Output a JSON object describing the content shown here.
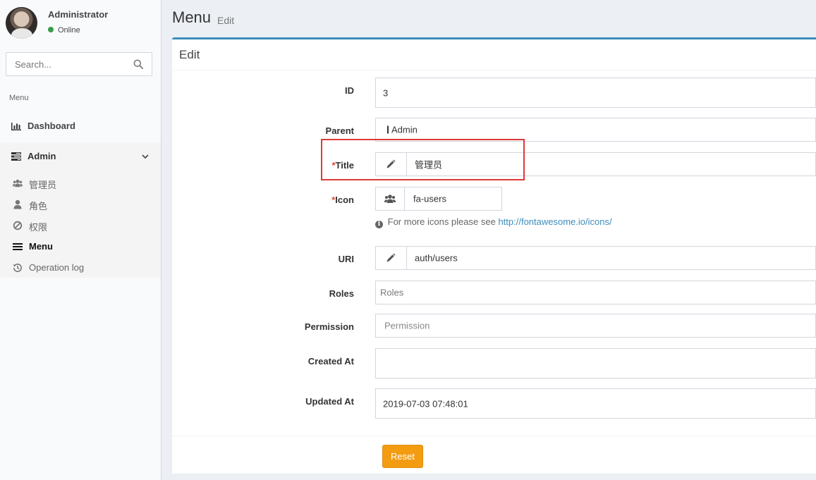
{
  "user": {
    "name": "Administrator",
    "status": "Online"
  },
  "search": {
    "placeholder": "Search..."
  },
  "sidebar": {
    "header": "Menu",
    "dashboard": "Dashboard",
    "admin": "Admin",
    "sub_items": [
      {
        "label": "管理员",
        "icon": "users-icon"
      },
      {
        "label": "角色",
        "icon": "user-icon"
      },
      {
        "label": "权限",
        "icon": "ban-icon"
      },
      {
        "label": "Menu",
        "icon": "bars-icon"
      },
      {
        "label": "Operation log",
        "icon": "history-icon"
      }
    ]
  },
  "page": {
    "title": "Menu",
    "subtitle": "Edit"
  },
  "box": {
    "title": "Edit"
  },
  "form": {
    "id": {
      "label": "ID",
      "value": "3"
    },
    "parent": {
      "label": "Parent",
      "value": "Admin"
    },
    "title": {
      "required_mark": "*",
      "label": "Title",
      "value": "管理员"
    },
    "icon": {
      "required_mark": "*",
      "label": "Icon",
      "value": "fa-users"
    },
    "help": {
      "text": "For more icons please see",
      "link": "http://fontawesome.io/icons/"
    },
    "uri": {
      "label": "URI",
      "value": "auth/users"
    },
    "roles": {
      "label": "Roles",
      "placeholder": "Roles"
    },
    "permission": {
      "label": "Permission",
      "placeholder": "Permission"
    },
    "created_at": {
      "label": "Created At",
      "value": ""
    },
    "updated_at": {
      "label": "Updated At",
      "value": "2019-07-03 07:48:01"
    }
  },
  "footer": {
    "reset_label": "Reset"
  },
  "colors": {
    "primary": "#3c8dbc",
    "warning": "#f39c12",
    "required": "#dd4b39",
    "highlight": "#e03838",
    "online": "#3c9a48"
  }
}
